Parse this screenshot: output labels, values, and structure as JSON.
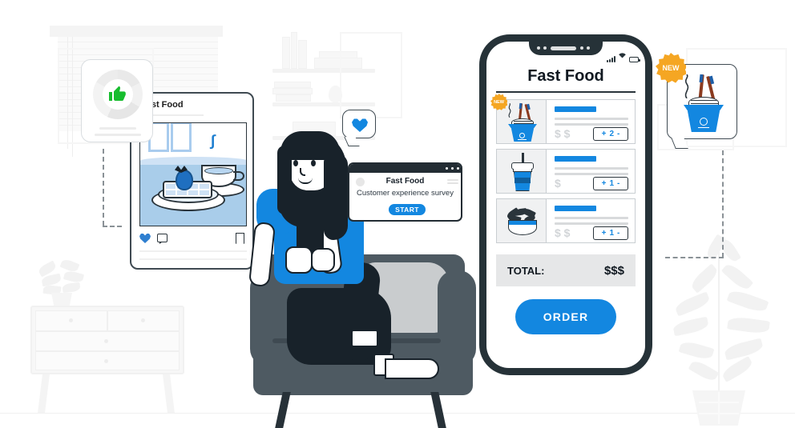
{
  "scene": {
    "title": "Fast Food ordering illustration",
    "colors": {
      "brand_blue": "#1387E0",
      "dark_slate": "#263238",
      "accent_orange": "#F5A623",
      "thumb_green": "#17BD2E",
      "light_gray": "#F0F1F2"
    }
  },
  "stat_card": {
    "icon": "thumbs-up-icon",
    "chart_type": "donut"
  },
  "post_card": {
    "title": "Fast Food",
    "image_alt": "waffle-with-strawberry-and-coffee",
    "actions": {
      "like": "heart-icon",
      "comment": "comment-icon",
      "save": "bookmark-icon"
    }
  },
  "heart_bubble": {
    "icon": "heart-icon"
  },
  "survey_window": {
    "title": "Fast Food",
    "subtitle": "Customer experience survey",
    "start_label": "START",
    "window_controls": "three-dots-icon"
  },
  "new_bubble": {
    "badge": "NEW",
    "icon": "noodle-box-icon"
  },
  "phone": {
    "status_bar": {
      "signal": "signal-bars-icon",
      "wifi": "wifi-icon",
      "battery": "battery-icon"
    },
    "title": "Fast Food",
    "menu_items": [
      {
        "icon": "noodle-box-icon",
        "badge": "NEW",
        "price": "$ $",
        "qty": "2",
        "plus": "+",
        "minus": "-"
      },
      {
        "icon": "drink-cup-icon",
        "badge": "",
        "price": "$",
        "qty": "1",
        "plus": "+",
        "minus": "-"
      },
      {
        "icon": "salad-bowl-icon",
        "badge": "",
        "price": "$ $",
        "qty": "1",
        "plus": "+",
        "minus": "-"
      }
    ],
    "total_label": "TOTAL:",
    "total_value": "$$$",
    "order_label": "ORDER"
  }
}
